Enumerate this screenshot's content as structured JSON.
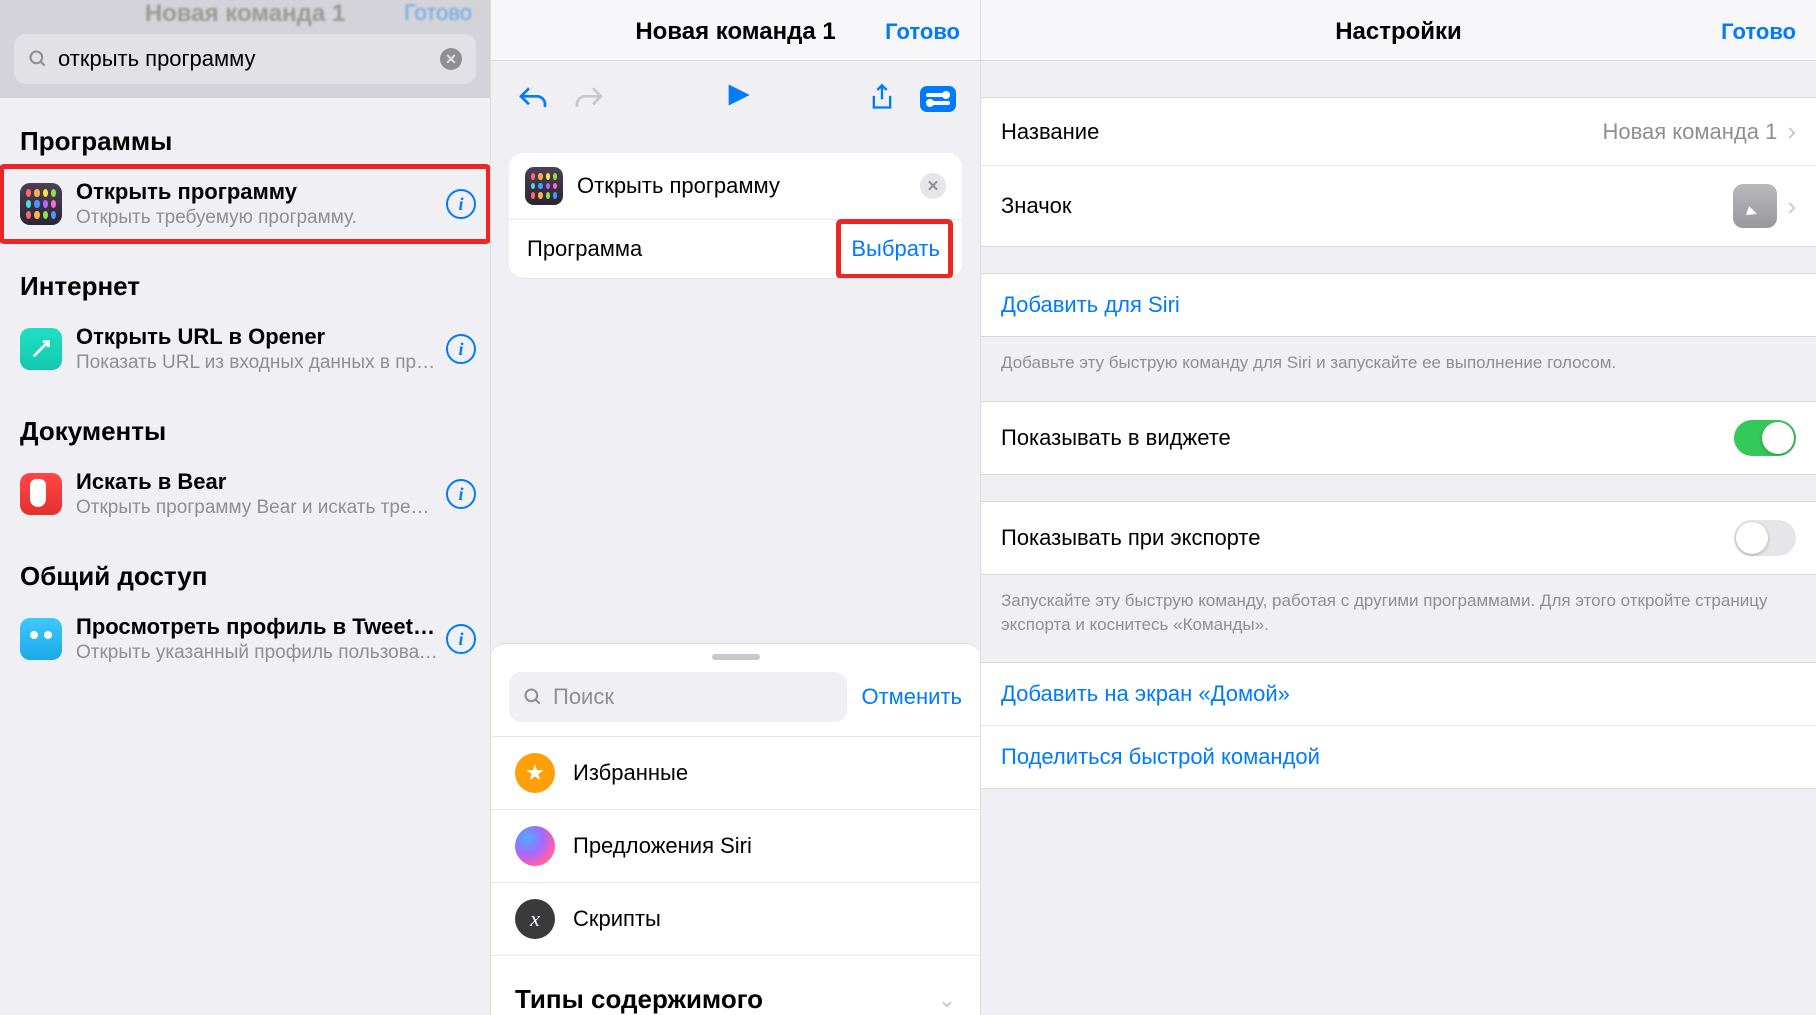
{
  "left": {
    "header_dim_title": "Новая команда 1",
    "header_dim_done": "Готово",
    "search_value": "открыть программу",
    "sections": [
      {
        "title": "Программы",
        "item": {
          "title": "Открыть программу",
          "sub": "Открыть требуемую программу."
        }
      },
      {
        "title": "Интернет",
        "item": {
          "title": "Открыть URL в Opener",
          "sub": "Показать URL из входных данных в прог…"
        }
      },
      {
        "title": "Документы",
        "item": {
          "title": "Искать в Bear",
          "sub": "Открыть программу Bear и искать требу…"
        }
      },
      {
        "title": "Общий доступ",
        "item": {
          "title": "Просмотреть профиль в Tweet…",
          "sub": "Открыть указанный профиль пользовате…"
        }
      }
    ]
  },
  "middle": {
    "title": "Новая команда 1",
    "done": "Готово",
    "action": {
      "title": "Открыть программу",
      "param_label": "Программа",
      "choose": "Выбрать"
    },
    "sheet": {
      "search_placeholder": "Поиск",
      "cancel": "Отменить",
      "rows": [
        "Избранные",
        "Предложения Siri",
        "Скрипты"
      ],
      "section": "Типы содержимого"
    }
  },
  "right": {
    "title": "Настройки",
    "done": "Готово",
    "name_label": "Название",
    "name_value": "Новая команда 1",
    "icon_label": "Значок",
    "add_siri": "Добавить для Siri",
    "siri_note": "Добавьте эту быструю команду для Siri и запускайте ее выполнение голосом.",
    "widget_label": "Показывать в виджете",
    "export_label": "Показывать при экспорте",
    "export_note": "Запускайте эту быструю команду, работая с другими программами. Для этого откройте страницу экспорта и коснитесь «Команды».",
    "add_home": "Добавить на экран «Домой»",
    "share_cmd": "Поделиться быстрой командой"
  }
}
